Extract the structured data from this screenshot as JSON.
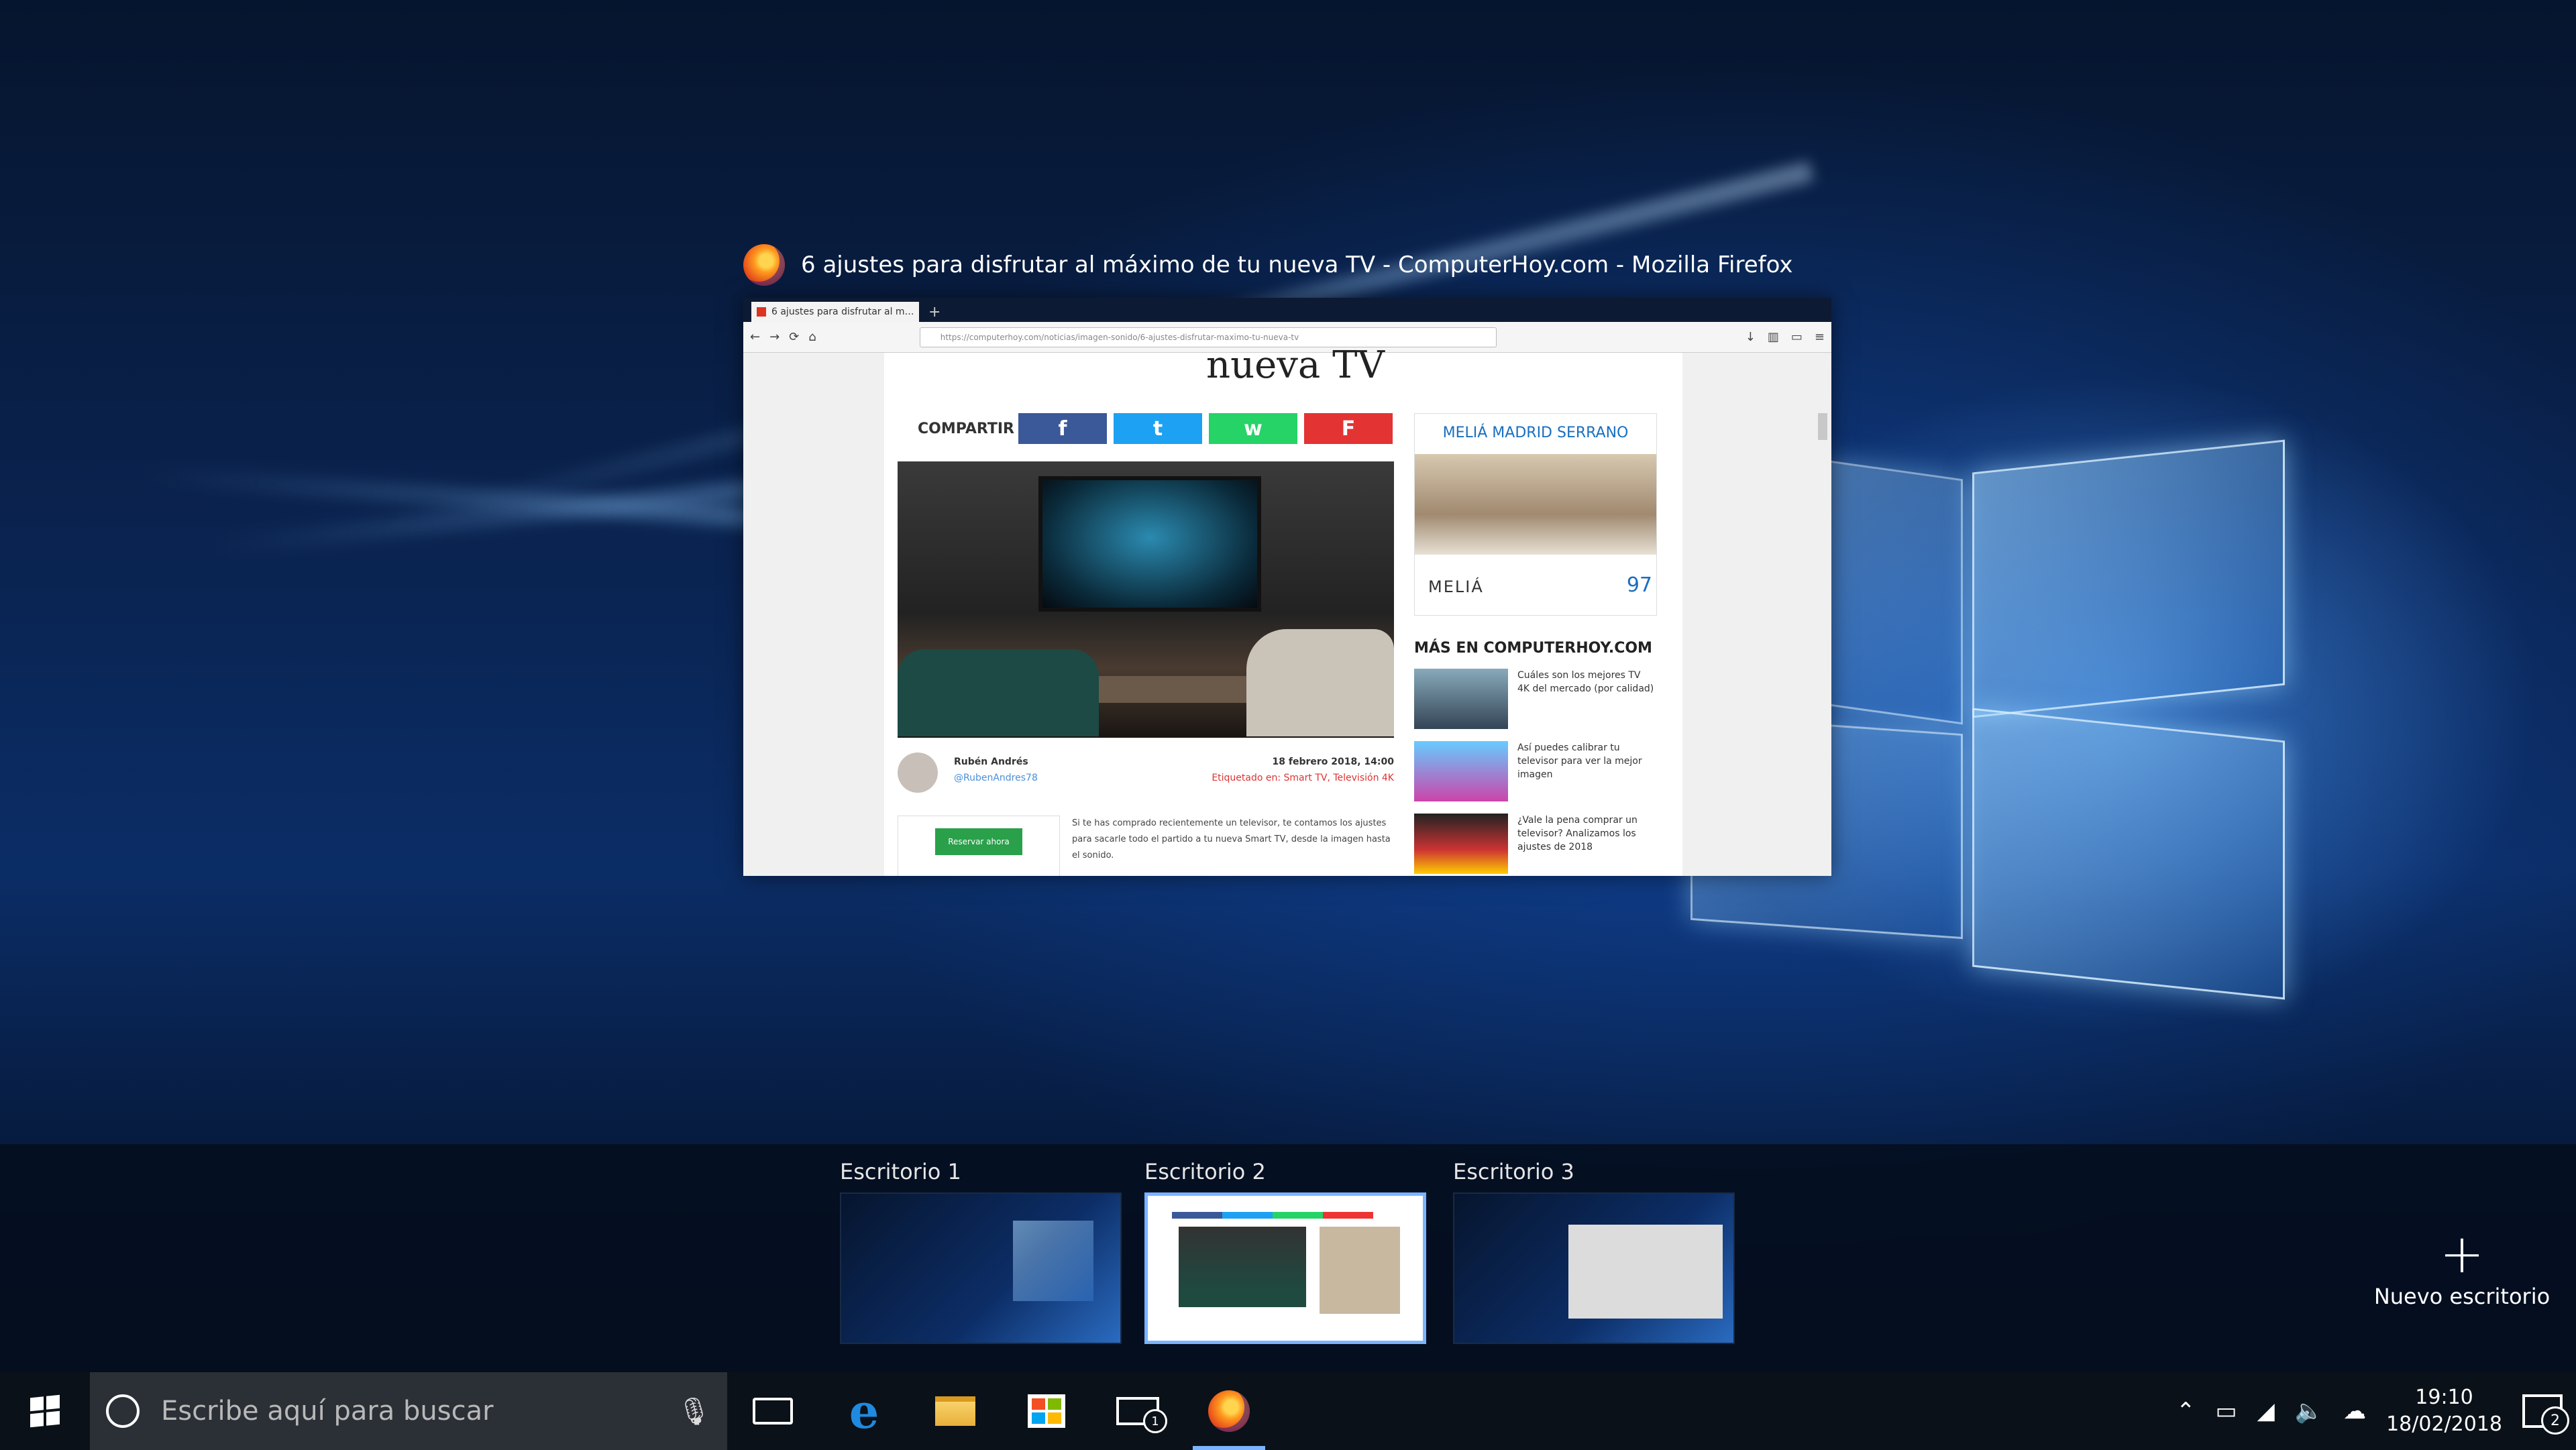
{
  "window_preview": {
    "title": "6 ajustes para disfrutar al máximo de tu nueva TV - ComputerHoy.com - Mozilla Firefox",
    "tab_label": "6 ajustes para disfrutar al m…",
    "url": "https://computerhoy.com/noticias/imagen-sonido/6-ajustes-disfrutar-maximo-tu-nueva-tv",
    "article": {
      "heading": "nueva TV",
      "share_label": "COMPARTIR",
      "share_buttons": [
        "f",
        "t",
        "w",
        "F"
      ],
      "author_name": "Rubén Andrés",
      "author_twitter": "@RubenAndres78",
      "date": "18 febrero 2018, 14:00",
      "tags": "Etiquetado en: Smart TV, Televisión 4K",
      "ad_button": "Reservar ahora",
      "body": "Si te has comprado recientemente un televisor, te contamos los ajustes para sacarle todo el partido a tu nueva Smart TV, desde la imagen hasta el sonido."
    },
    "sidebar": {
      "ad_title": "MELIÁ MADRID SERRANO",
      "ad_brand": "MELIÁ",
      "ad_price": "97",
      "more_heading": "MÁS EN COMPUTERHOY.COM",
      "more_items": [
        "Cuáles son los mejores TV 4K del mercado (por calidad)",
        "Así puedes calibrar tu televisor para ver la mejor imagen",
        "¿Vale la pena comprar un televisor? Analizamos los ajustes de 2018"
      ]
    }
  },
  "virtual_desktops": [
    {
      "label": "Escritorio 1",
      "active": false
    },
    {
      "label": "Escritorio 2",
      "active": true
    },
    {
      "label": "Escritorio 3",
      "active": false
    }
  ],
  "new_desktop": {
    "plus": "+",
    "label": "Nuevo escritorio"
  },
  "taskbar": {
    "search_placeholder": "Escribe aquí para buscar",
    "pinned_icons": [
      "task-view-icon",
      "edge-icon",
      "file-explorer-icon",
      "store-icon",
      "mail-icon",
      "firefox-icon"
    ],
    "mail_badge": "1",
    "tray_icons": [
      "chevron-up-icon",
      "battery-icon",
      "wifi-icon",
      "volume-icon",
      "onedrive-icon"
    ],
    "clock_time": "19:10",
    "clock_date": "18/02/2018",
    "notification_count": "2"
  },
  "colors": {
    "accent": "#7ab4ff",
    "taskbar_bg": "#0b1118",
    "facebook": "#3b5998",
    "twitter": "#1da1f2",
    "whatsapp": "#25d366",
    "flipboard": "#e33333"
  }
}
